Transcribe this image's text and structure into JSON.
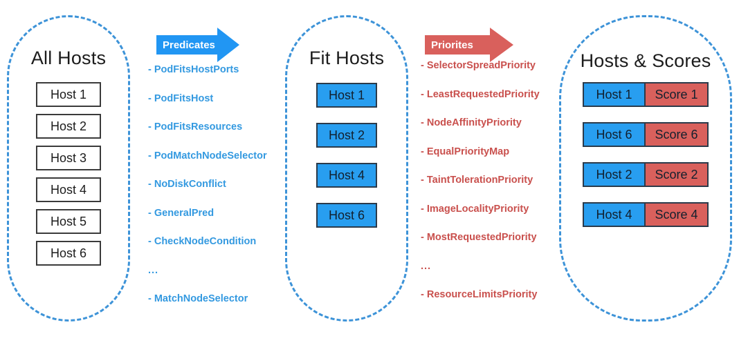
{
  "panels": {
    "all_hosts": {
      "title": "All Hosts",
      "hosts": [
        "Host 1",
        "Host 2",
        "Host 3",
        "Host 4",
        "Host 5",
        "Host 6"
      ]
    },
    "fit_hosts": {
      "title": "Fit Hosts",
      "hosts": [
        "Host 1",
        "Host 2",
        "Host 4",
        "Host 6"
      ]
    },
    "hosts_scores": {
      "title": "Hosts & Scores",
      "rows": [
        {
          "host": "Host 1",
          "score": "Score 1"
        },
        {
          "host": "Host 6",
          "score": "Score 6"
        },
        {
          "host": "Host 2",
          "score": "Score 2"
        },
        {
          "host": "Host 4",
          "score": "Score 4"
        }
      ]
    }
  },
  "arrows": {
    "predicates": {
      "label": "Predicates",
      "color": "#2196f3"
    },
    "priorities": {
      "label": "Priorites",
      "color": "#d9605c"
    }
  },
  "predicates": {
    "color": "#3399e0",
    "items": [
      "- PodFitsHostPorts",
      "- PodFitsHost",
      "- PodFitsResources",
      "- PodMatchNodeSelector",
      "- NoDiskConflict",
      "- GeneralPred",
      "- CheckNodeCondition",
      "...",
      "- MatchNodeSelector"
    ]
  },
  "priorities": {
    "color": "#c9504d",
    "items": [
      "- SelectorSpreadPriority",
      "- LeastRequestedPriority",
      "- NodeAffinityPriority",
      "- EqualPriorityMap",
      "- TaintTolerationPriority",
      "- ImageLocalityPriority",
      "- MostRequestedPriority",
      "...",
      "- ResourceLimitsPriority"
    ]
  },
  "colors": {
    "panel_border": "#3d93d8",
    "host_box_blue": "#289ef0",
    "score_box_red": "#d9605c",
    "box_outline": "#2b3a4a"
  }
}
